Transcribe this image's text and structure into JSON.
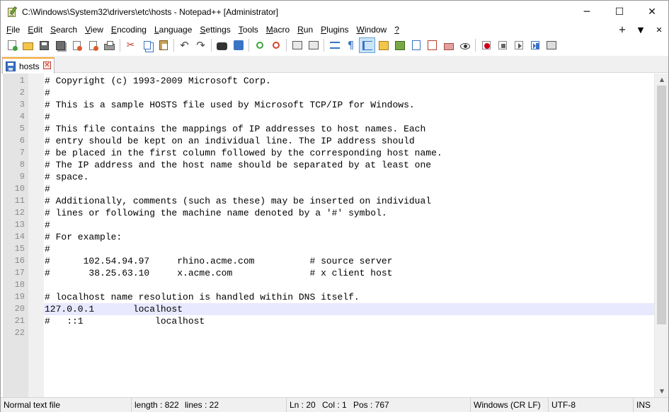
{
  "window": {
    "title": "C:\\Windows\\System32\\drivers\\etc\\hosts - Notepad++ [Administrator]",
    "controls": {
      "minimize": "─",
      "maximize": "☐",
      "close": "✕"
    }
  },
  "menu": {
    "items": [
      {
        "mn": "F",
        "rest": "ile"
      },
      {
        "mn": "E",
        "rest": "dit"
      },
      {
        "mn": "S",
        "rest": "earch"
      },
      {
        "mn": "V",
        "rest": "iew"
      },
      {
        "mn": "E",
        "rest": "ncoding"
      },
      {
        "mn": "L",
        "rest": "anguage"
      },
      {
        "mn": "S",
        "rest": "ettings"
      },
      {
        "mn": "T",
        "rest": "ools"
      },
      {
        "mn": "M",
        "rest": "acro"
      },
      {
        "mn": "R",
        "rest": "un"
      },
      {
        "mn": "P",
        "rest": "lugins"
      },
      {
        "mn": "W",
        "rest": "indow"
      },
      {
        "mn": "?",
        "rest": ""
      }
    ],
    "right": {
      "add": "+",
      "dropdown": "▼",
      "close": "✕"
    }
  },
  "tabs": [
    {
      "label": "hosts",
      "close": "✕"
    }
  ],
  "editor": {
    "current_line": 20,
    "lines": [
      {
        "n": "1",
        "text": "# Copyright (c) 1993-2009 Microsoft Corp."
      },
      {
        "n": "2",
        "text": "#"
      },
      {
        "n": "3",
        "text": "# This is a sample HOSTS file used by Microsoft TCP/IP for Windows."
      },
      {
        "n": "4",
        "text": "#"
      },
      {
        "n": "5",
        "text": "# This file contains the mappings of IP addresses to host names. Each"
      },
      {
        "n": "6",
        "text": "# entry should be kept on an individual line. The IP address should"
      },
      {
        "n": "7",
        "text": "# be placed in the first column followed by the corresponding host name."
      },
      {
        "n": "8",
        "text": "# The IP address and the host name should be separated by at least one"
      },
      {
        "n": "9",
        "text": "# space."
      },
      {
        "n": "10",
        "text": "#"
      },
      {
        "n": "11",
        "text": "# Additionally, comments (such as these) may be inserted on individual"
      },
      {
        "n": "12",
        "text": "# lines or following the machine name denoted by a '#' symbol."
      },
      {
        "n": "13",
        "text": "#"
      },
      {
        "n": "14",
        "text": "# For example:"
      },
      {
        "n": "15",
        "text": "#"
      },
      {
        "n": "16",
        "text": "#      102.54.94.97     rhino.acme.com          # source server"
      },
      {
        "n": "17",
        "text": "#       38.25.63.10     x.acme.com              # x client host"
      },
      {
        "n": "18",
        "text": ""
      },
      {
        "n": "19",
        "text": "# localhost name resolution is handled within DNS itself."
      },
      {
        "n": "20",
        "text": "127.0.0.1       localhost"
      },
      {
        "n": "21",
        "text": "#   ::1             localhost"
      },
      {
        "n": "22",
        "text": ""
      }
    ]
  },
  "status": {
    "file_type": "Normal text file",
    "length": "length : 822",
    "lines": "lines : 22",
    "ln": "Ln : 20",
    "col": "Col : 1",
    "pos": "Pos : 767",
    "eol": "Windows (CR LF)",
    "encoding": "UTF-8",
    "mode": "INS"
  },
  "toolbar": {
    "buttons": [
      {
        "icon": "new-file-icon",
        "cls": "i-new"
      },
      {
        "icon": "open-file-icon",
        "cls": "i-open"
      },
      {
        "icon": "save-icon",
        "cls": "i-save"
      },
      {
        "icon": "save-all-icon",
        "cls": "i-saveall"
      },
      {
        "icon": "close-file-icon",
        "cls": "i-close"
      },
      {
        "icon": "close-all-icon",
        "cls": "i-close"
      },
      {
        "icon": "print-icon",
        "cls": "i-print"
      },
      {
        "sep": true
      },
      {
        "icon": "cut-icon",
        "cls": "i-cut",
        "glyph": "✂"
      },
      {
        "icon": "copy-icon",
        "cls": "i-copy"
      },
      {
        "icon": "paste-icon",
        "cls": "i-paste"
      },
      {
        "sep": true
      },
      {
        "icon": "undo-icon",
        "cls": "i-undo",
        "glyph": "↶"
      },
      {
        "icon": "redo-icon",
        "cls": "i-redo",
        "glyph": "↷"
      },
      {
        "sep": true
      },
      {
        "icon": "find-icon",
        "cls": "i-find"
      },
      {
        "icon": "replace-icon",
        "cls": "i-replace"
      },
      {
        "sep": true
      },
      {
        "icon": "zoom-in-icon",
        "cls": "i-zoomin"
      },
      {
        "icon": "zoom-out-icon",
        "cls": "i-zoomout"
      },
      {
        "sep": true
      },
      {
        "icon": "sync-vertical-icon",
        "cls": "i-box"
      },
      {
        "icon": "sync-horizontal-icon",
        "cls": "i-box"
      },
      {
        "sep": true
      },
      {
        "icon": "word-wrap-icon",
        "cls": "i-wrap"
      },
      {
        "icon": "show-all-chars-icon",
        "cls": "i-para",
        "glyph": "¶"
      },
      {
        "icon": "indent-guide-icon",
        "cls": "i-indent",
        "active": true
      },
      {
        "icon": "user-language-icon",
        "cls": "i-lang"
      },
      {
        "icon": "document-map-icon",
        "cls": "i-map"
      },
      {
        "icon": "document-list-icon",
        "cls": "i-doc"
      },
      {
        "icon": "function-list-icon",
        "cls": "i-func"
      },
      {
        "icon": "folder-workspace-icon",
        "cls": "i-folder"
      },
      {
        "icon": "monitoring-icon",
        "cls": "i-eye"
      },
      {
        "sep": true
      },
      {
        "icon": "record-macro-icon",
        "cls": "i-rec"
      },
      {
        "icon": "stop-macro-icon",
        "cls": "i-stop"
      },
      {
        "icon": "play-macro-icon",
        "cls": "i-play"
      },
      {
        "icon": "run-macro-multiple-icon",
        "cls": "i-playm"
      },
      {
        "icon": "save-macro-icon",
        "cls": "i-savemacro"
      }
    ]
  }
}
